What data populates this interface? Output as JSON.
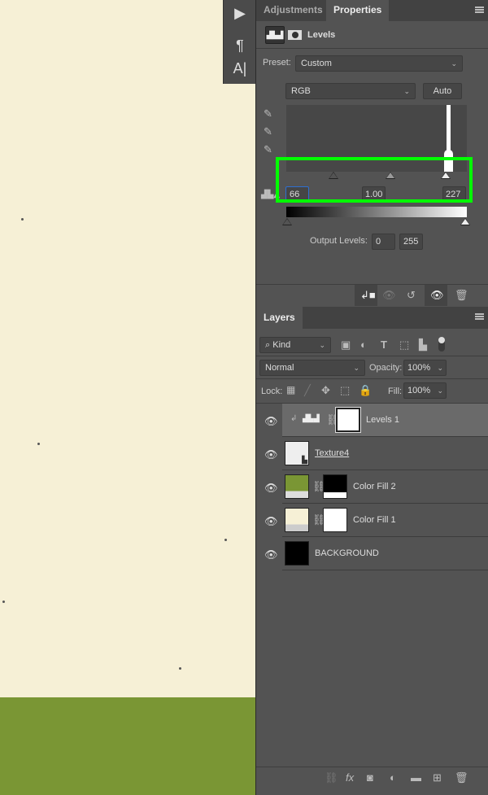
{
  "canvas": {
    "colors": {
      "cream": "#f6f0d6",
      "green": "#7a9634"
    }
  },
  "toolbar": {
    "icons": [
      "play-icon",
      "paragraph-icon",
      "character-icon"
    ],
    "play": "▶",
    "paragraph": "¶",
    "character": "A|"
  },
  "properties": {
    "tabs": [
      {
        "label": "Adjustments"
      },
      {
        "label": "Properties",
        "active": true
      }
    ],
    "adjustment_title": "Levels",
    "preset_label": "Preset:",
    "preset_value": "Custom",
    "channel_value": "RGB",
    "auto_label": "Auto",
    "input_levels": {
      "shadow": "66",
      "midtone": "1.00",
      "highlight": "227"
    },
    "output_label": "Output Levels:",
    "output_levels": {
      "black": "0",
      "white": "255"
    },
    "highlight_color": "#00ff00"
  },
  "layers": {
    "tab_label": "Layers",
    "filter_value": "Kind",
    "blend_mode": "Normal",
    "opacity_label": "Opacity:",
    "opacity_value": "100%",
    "lock_label": "Lock:",
    "fill_label": "Fill:",
    "fill_value": "100%",
    "items": [
      {
        "name": "Levels 1",
        "selected": true
      },
      {
        "name": "Texture4"
      },
      {
        "name": "Color Fill 2"
      },
      {
        "name": "Color Fill 1"
      },
      {
        "name": "BACKGROUND"
      }
    ]
  }
}
